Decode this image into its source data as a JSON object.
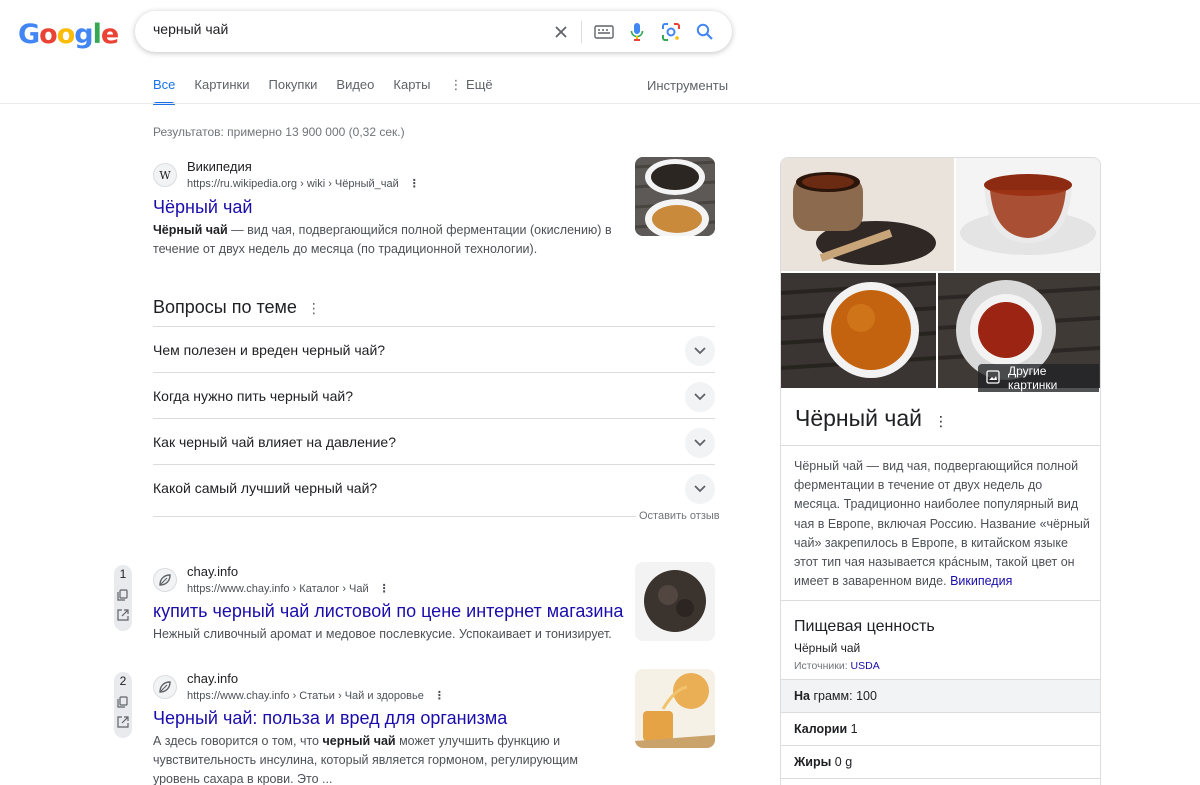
{
  "logo": [
    "G",
    "o",
    "o",
    "g",
    "l",
    "e"
  ],
  "search": {
    "query": "черный чай"
  },
  "tabs": [
    {
      "label": "Все"
    },
    {
      "label": "Картинки"
    },
    {
      "label": "Покупки"
    },
    {
      "label": "Видео"
    },
    {
      "label": "Карты"
    },
    {
      "label": "⋮ Ещё"
    }
  ],
  "tools_label": "Инструменты",
  "stats": "Результатов: примерно 13 900 000 (0,32 сек.)",
  "wiki": {
    "site": "Википедия",
    "fav": "W",
    "url": "https://ru.wikipedia.org › wiki › Чёрный_чай",
    "title": "Чёрный чай",
    "snippet_bold": "Чёрный чай",
    "snippet_rest": " — вид чая, подвергающийся полной ферментации (окислению) в течение от двух недель до месяца (по традиционной технологии)."
  },
  "paa": {
    "title": "Вопросы по теме",
    "questions": [
      "Чем полезен и вреден черный чай?",
      "Когда нужно пить черный чай?",
      "Как черный чай влияет на давление?",
      "Какой самый лучший черный чай?"
    ],
    "feedback": "Оставить отзыв"
  },
  "results": [
    {
      "num": "1",
      "site": "chay.info",
      "url": "https://www.chay.info › Каталог › Чай",
      "title": "купить черный чай листовой по цене интернет магазина",
      "snippet": "Нежный сливочный аромат и медовое послевкусие. Успокаивает и тонизирует."
    },
    {
      "num": "2",
      "site": "chay.info",
      "url": "https://www.chay.info › Статьи › Чай и здоровье",
      "title": "Черный чай: польза и вред для организма",
      "snippet_a": "А здесь говорится о том, что ",
      "snippet_bold": "черный чай",
      "snippet_b": " может улучшить функцию и чувствительность инсулина, который является гормоном, регулирующим уровень сахара в крови. Это ..."
    }
  ],
  "kp": {
    "more_images": "Другие картинки",
    "title": "Чёрный чай",
    "desc": "Чёрный чай — вид чая, подвергающийся полной ферментации в течение от двух недель до месяца. Традиционно наиболее популярный вид чая в Европе, включая Россию. Название «чёрный чай» закрепилось в Европе, в китайском языке этот тип чая называется кра́сным, такой цвет он имеет в заваренном виде.",
    "desc_link": "Википедия",
    "nutrition_title": "Пищевая ценность",
    "nutrition_sub": "Чёрный чай",
    "sources_label": "Источники:",
    "sources_link": "USDA",
    "rows": [
      {
        "label": "На",
        "value": "грамм: 100"
      },
      {
        "label": "Калории",
        "value": "1"
      },
      {
        "label": "Жиры",
        "value": "0 g"
      }
    ]
  },
  "colors": {
    "link": "#1a0dab",
    "accent": "#1a73e8",
    "muted": "#70757a"
  }
}
